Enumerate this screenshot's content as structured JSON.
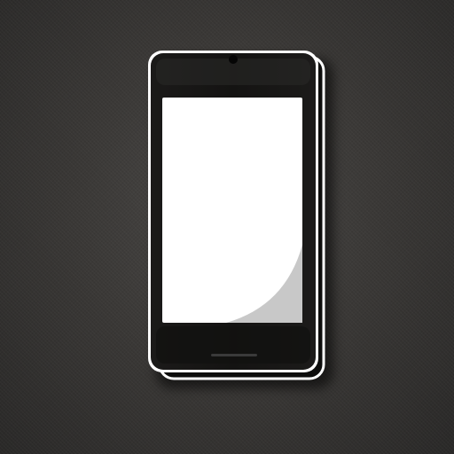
{
  "scene": {
    "subject": "smartphone-icon",
    "colors": {
      "background": "#3b3937",
      "phone_body": "#151413",
      "phone_outline": "#ffffff",
      "screen": "#ffffff",
      "screen_glare": "#c8c8c8",
      "home_bar": "#3a3a3a"
    }
  }
}
